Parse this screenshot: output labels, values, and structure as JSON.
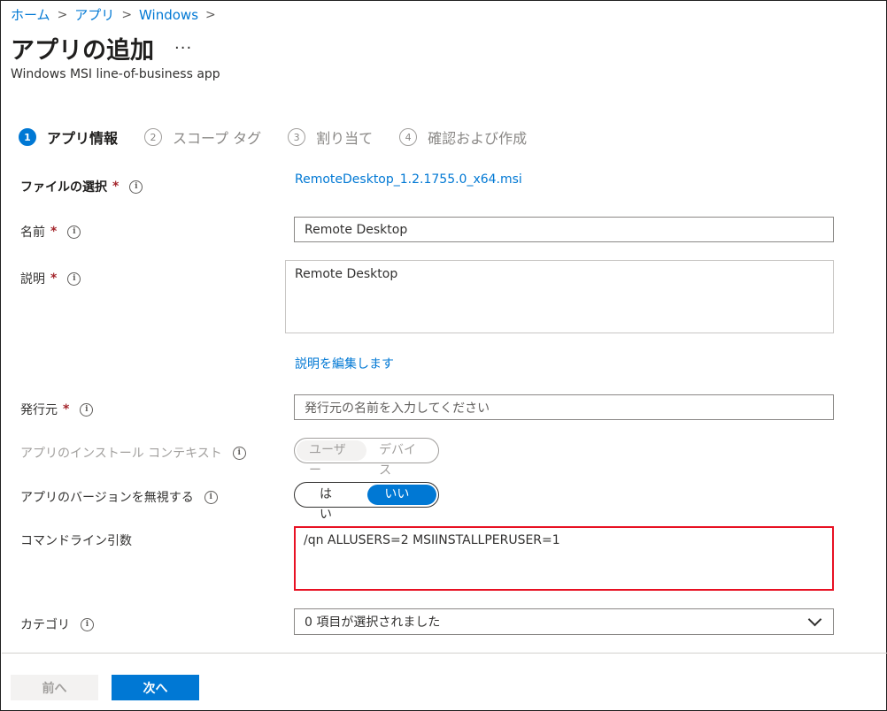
{
  "breadcrumb": [
    "ホーム",
    "アプリ",
    "Windows"
  ],
  "page": {
    "title": "アプリの追加",
    "more": "...",
    "subtitle": "Windows MSI line-of-business app"
  },
  "steps": [
    {
      "num": "1",
      "label": "アプリ情報",
      "active": true
    },
    {
      "num": "2",
      "label": "スコープ タグ",
      "active": false
    },
    {
      "num": "3",
      "label": "割り当て",
      "active": false
    },
    {
      "num": "4",
      "label": "確認および作成",
      "active": false
    }
  ],
  "form": {
    "file": {
      "label": "ファイルの選択",
      "required": "*",
      "value": "RemoteDesktop_1.2.1755.0_x64.msi"
    },
    "name": {
      "label": "名前",
      "required": "*",
      "value": "Remote Desktop"
    },
    "description": {
      "label": "説明",
      "required": "*",
      "value": "Remote Desktop",
      "edit_link": "説明を編集します"
    },
    "publisher": {
      "label": "発行元",
      "required": "*",
      "placeholder": "発行元の名前を入力してください"
    },
    "install_context": {
      "label": "アプリのインストール コンテキスト",
      "options": [
        "ユーザー",
        "デバイス"
      ],
      "selected": "ユーザー",
      "disabled": true
    },
    "ignore_version": {
      "label": "アプリのバージョンを無視する",
      "options": [
        "はい",
        "いいえ"
      ],
      "selected": "いいえ"
    },
    "command_line": {
      "label": "コマンドライン引数",
      "value": "/qn ALLUSERS=2 MSIINSTALLPERUSER=1"
    },
    "category": {
      "label": "カテゴリ",
      "value": "0 項目が選択されました"
    }
  },
  "footer": {
    "prev": "前へ",
    "next": "次へ"
  },
  "colors": {
    "accent": "#0078d4",
    "highlight_border": "#e81123",
    "required": "#a4262c"
  },
  "icons": {
    "info": "info-circle-icon",
    "chevron": "chevron-down-icon"
  }
}
